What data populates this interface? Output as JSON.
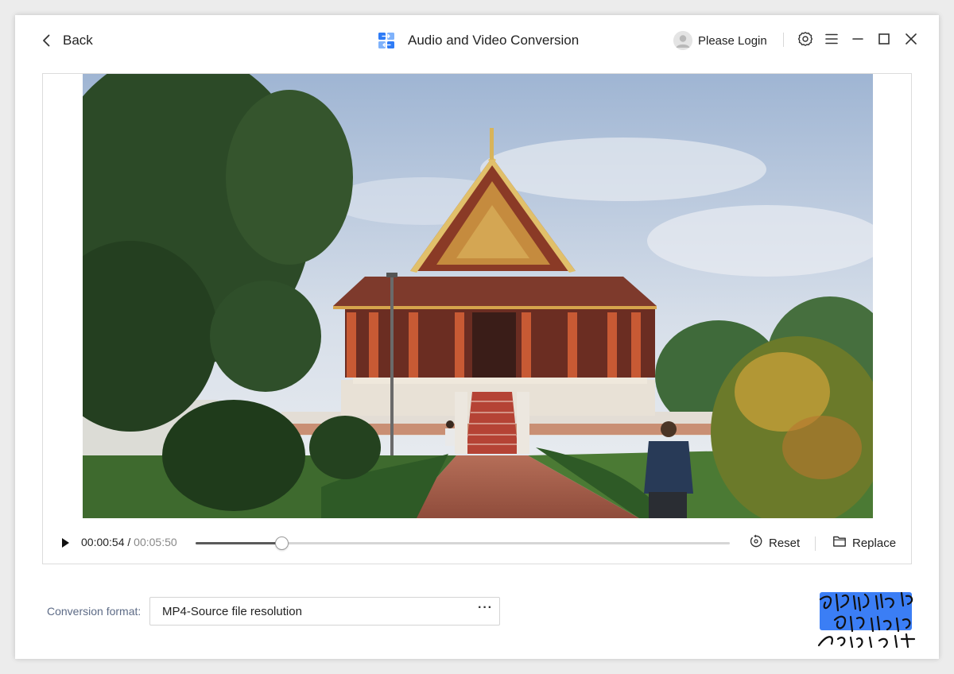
{
  "header": {
    "back_label": "Back",
    "title": "Audio and Video Conversion",
    "login_label": "Please Login",
    "icons": [
      "back-arrow-icon",
      "app-logo-icon",
      "user-avatar-icon",
      "gear-icon",
      "menu-icon",
      "minimize-icon",
      "maximize-icon",
      "close-icon"
    ]
  },
  "player": {
    "current_time": "00:00:54",
    "separator": " / ",
    "duration": "00:05:50",
    "progress": 0.16,
    "reset_label": "Reset",
    "replace_label": "Replace"
  },
  "format": {
    "label": "Conversion format:",
    "value": "MP4-Source file resolution",
    "more": "···"
  },
  "colors": {
    "accent": "#3b7ef5",
    "app_icon_blue": "#2f7cf6",
    "label_muted": "#5d6b86"
  }
}
